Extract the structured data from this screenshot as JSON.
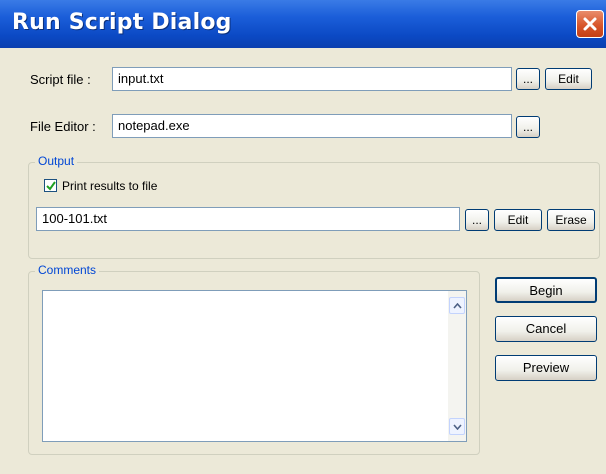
{
  "window": {
    "title": "Run Script Dialog",
    "close_icon": "close-icon"
  },
  "script_file": {
    "label": "Script file :",
    "value": "input.txt",
    "browse_label": "...",
    "edit_label": "Edit"
  },
  "file_editor": {
    "label": "File Editor :",
    "value": "notepad.exe",
    "browse_label": "..."
  },
  "output": {
    "group_label": "Output",
    "print_results_label": "Print results to file",
    "print_results_checked": true,
    "file_value": "100-101.txt",
    "browse_label": "...",
    "edit_label": "Edit",
    "erase_label": "Erase"
  },
  "comments": {
    "group_label": "Comments",
    "value": ""
  },
  "actions": {
    "begin_label": "Begin",
    "cancel_label": "Cancel",
    "preview_label": "Preview"
  },
  "colors": {
    "title_bar": "#0B49C4",
    "dialog_bg": "#ECE9D8",
    "group_title": "#0046D5",
    "close_button": "#D8572C"
  }
}
